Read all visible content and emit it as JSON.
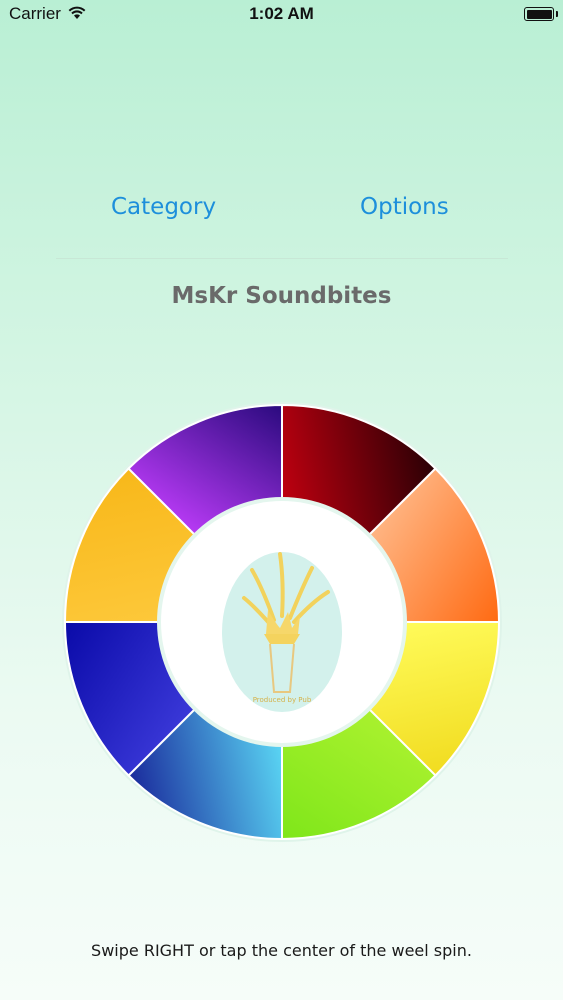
{
  "status_bar": {
    "carrier": "Carrier",
    "time": "1:02 AM"
  },
  "nav": {
    "category_label": "Category",
    "options_label": "Options"
  },
  "title": "MsKr Soundbites",
  "wheel": {
    "segments": [
      {
        "color": "#c00010",
        "color_dark": "#2a0005"
      },
      {
        "color": "#ffb583",
        "color_dark": "#ff6a12"
      },
      {
        "color": "#fffb5a",
        "color_dark": "#f1dc20"
      },
      {
        "color": "#a9f12e",
        "color_dark": "#7fe61a"
      },
      {
        "color": "#5ad6f4",
        "color_dark": "#1a2a9c"
      },
      {
        "color": "#3a38d8",
        "color_dark": "#0a0aa8"
      },
      {
        "color": "#fdc83a",
        "color_dark": "#f8b81a"
      },
      {
        "color": "#b83af5",
        "color_dark": "#2a0a7e"
      }
    ],
    "center_logo_text": "Produced by Pub"
  },
  "hint": "Swipe RIGHT or tap the center of the weel spin."
}
